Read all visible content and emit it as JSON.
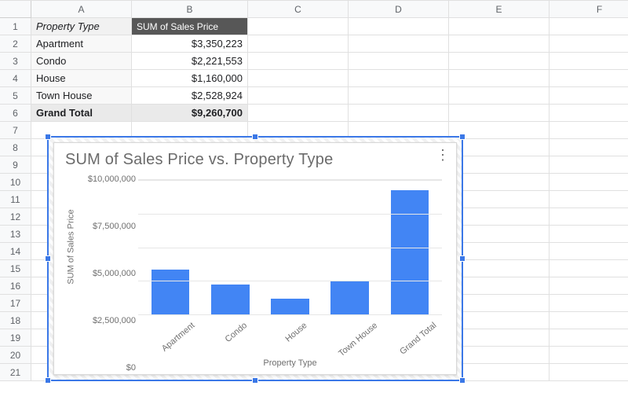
{
  "columns": [
    "A",
    "B",
    "C",
    "D",
    "E",
    "F"
  ],
  "row_count": 21,
  "pivot": {
    "headers": {
      "prop": "Property Type",
      "sum": "SUM of Sales Price"
    },
    "rows": [
      {
        "label": "Apartment",
        "value": "$3,350,223"
      },
      {
        "label": "Condo",
        "value": "$2,221,553"
      },
      {
        "label": "House",
        "value": "$1,160,000"
      },
      {
        "label": "Town House",
        "value": "$2,528,924"
      }
    ],
    "total": {
      "label": "Grand Total",
      "value": "$9,260,700"
    }
  },
  "chart_data": {
    "type": "bar",
    "title": "SUM of Sales Price vs. Property Type",
    "xlabel": "Property Type",
    "ylabel": "SUM of Sales Price",
    "ylim": [
      0,
      10000000
    ],
    "yticks": [
      {
        "v": 0,
        "label": "$0"
      },
      {
        "v": 2500000,
        "label": "$2,500,000"
      },
      {
        "v": 5000000,
        "label": "$5,000,000"
      },
      {
        "v": 7500000,
        "label": "$7,500,000"
      },
      {
        "v": 10000000,
        "label": "$10,000,000"
      }
    ],
    "categories": [
      "Apartment",
      "Condo",
      "House",
      "Town House",
      "Grand Total"
    ],
    "values": [
      3350223,
      2221553,
      1160000,
      2528924,
      9260700
    ]
  }
}
